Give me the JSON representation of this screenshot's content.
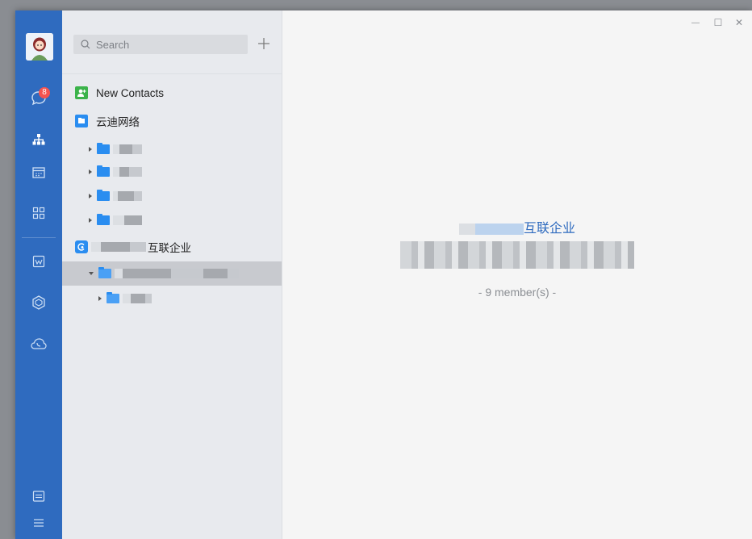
{
  "rail": {
    "accent": "#2f6bbf",
    "badge_count": "8",
    "icons": [
      "avatar",
      "chat-icon",
      "org-icon",
      "calendar-icon",
      "apps-icon",
      "doc-icon",
      "cube-icon",
      "cloud-icon",
      "settings-icon",
      "menu-icon"
    ]
  },
  "panel": {
    "search_placeholder": "Search",
    "new_contacts": "New Contacts",
    "company1_name": "云迪网络",
    "company2_name": "互联企业"
  },
  "main": {
    "org_name": "互联企业",
    "member_count": "- 9 member(s) -"
  },
  "window_controls": {
    "minimize": "—",
    "maximize": "☐",
    "close": "✕"
  }
}
